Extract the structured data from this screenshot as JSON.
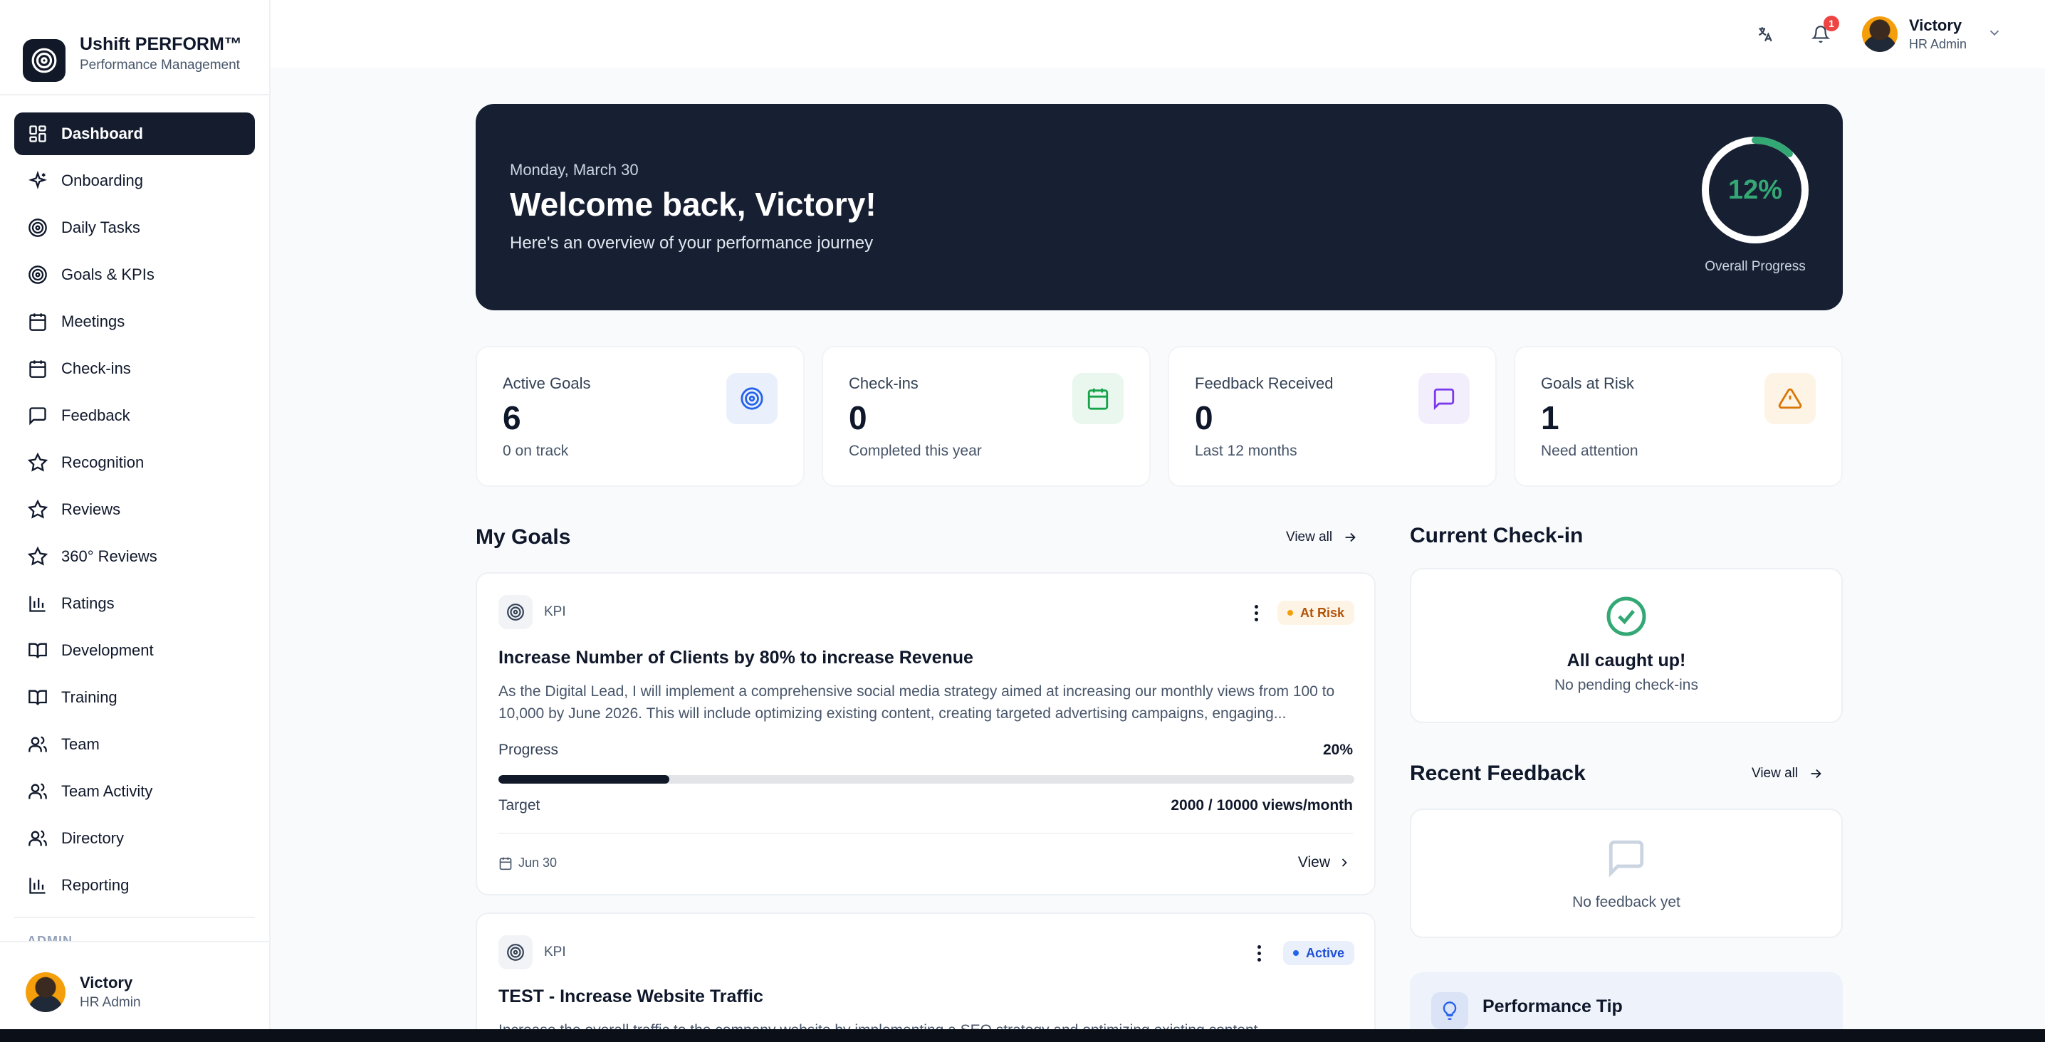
{
  "brand": {
    "name": "Ushift PERFORM™",
    "subtitle": "Performance Management"
  },
  "sidebar": {
    "items": [
      {
        "label": "Dashboard",
        "icon": "dashboard-icon",
        "active": true
      },
      {
        "label": "Onboarding",
        "icon": "sparkles-icon"
      },
      {
        "label": "Daily Tasks",
        "icon": "target-icon"
      },
      {
        "label": "Goals & KPIs",
        "icon": "target-icon"
      },
      {
        "label": "Meetings",
        "icon": "calendar-icon"
      },
      {
        "label": "Check-ins",
        "icon": "calendar-icon"
      },
      {
        "label": "Feedback",
        "icon": "message-icon"
      },
      {
        "label": "Recognition",
        "icon": "star-icon"
      },
      {
        "label": "Reviews",
        "icon": "star-icon"
      },
      {
        "label": "360° Reviews",
        "icon": "star-icon"
      },
      {
        "label": "Ratings",
        "icon": "bar-chart-icon"
      },
      {
        "label": "Development",
        "icon": "book-icon"
      },
      {
        "label": "Training",
        "icon": "book-icon"
      },
      {
        "label": "Team",
        "icon": "users-icon"
      },
      {
        "label": "Team Activity",
        "icon": "users-icon"
      },
      {
        "label": "Directory",
        "icon": "users-icon"
      },
      {
        "label": "Reporting",
        "icon": "bar-chart-icon"
      }
    ],
    "section_label": "ADMIN",
    "user": {
      "name": "Victory",
      "role": "HR Admin"
    }
  },
  "topbar": {
    "notification_count": "1",
    "user": {
      "name": "Victory",
      "role": "HR Admin"
    }
  },
  "hero": {
    "date": "Monday, March 30",
    "title": "Welcome back, Victory!",
    "subtitle": "Here's an overview of your performance journey",
    "progress_text": "12%",
    "progress_fraction": 0.12,
    "progress_label": "Overall Progress"
  },
  "stats": [
    {
      "label": "Active Goals",
      "value": "6",
      "sub": "0 on track",
      "icon": "target-icon",
      "color": "#2563eb",
      "bg": "#eaf0fb"
    },
    {
      "label": "Check-ins",
      "value": "0",
      "sub": "Completed this year",
      "icon": "calendar-icon",
      "color": "#16a34a",
      "bg": "#e9f7ee"
    },
    {
      "label": "Feedback Received",
      "value": "0",
      "sub": "Last 12 months",
      "icon": "message-icon",
      "color": "#7c3aed",
      "bg": "#f3eefc"
    },
    {
      "label": "Goals at Risk",
      "value": "1",
      "sub": "Need attention",
      "icon": "alert-triangle-icon",
      "color": "#d97706",
      "bg": "#fdf4e6"
    }
  ],
  "my_goals": {
    "title": "My Goals",
    "view_all": "View all",
    "goals": [
      {
        "type": "KPI",
        "status": "At Risk",
        "status_color": "#d97706",
        "status_bg": "#fdf4e6",
        "title": "Increase Number of Clients by 80% to increase Revenue",
        "description": "As the Digital Lead, I will implement a comprehensive social media strategy aimed at increasing our monthly views from 100 to 10,000 by June 2026. This will include optimizing existing content, creating targeted advertising campaigns, engaging...",
        "progress_label": "Progress",
        "progress_text": "20%",
        "progress_fraction": 0.2,
        "target_label": "Target",
        "target_value": "2000 / 10000 views/month",
        "due": "Jun 30",
        "view": "View"
      },
      {
        "type": "KPI",
        "status": "Active",
        "status_color": "#2563eb",
        "status_bg": "#eaf0fb",
        "title": "TEST - Increase Website Traffic",
        "description": "Increase the overall traffic to the company website by implementing a SEO strategy and optimizing existing content..."
      }
    ]
  },
  "checkin": {
    "title": "Current Check-in",
    "empty_title": "All caught up!",
    "empty_sub": "No pending check-ins"
  },
  "recent_feedback": {
    "title": "Recent Feedback",
    "view_all": "View all",
    "empty": "No feedback yet"
  },
  "tip": {
    "title": "Performance Tip"
  }
}
